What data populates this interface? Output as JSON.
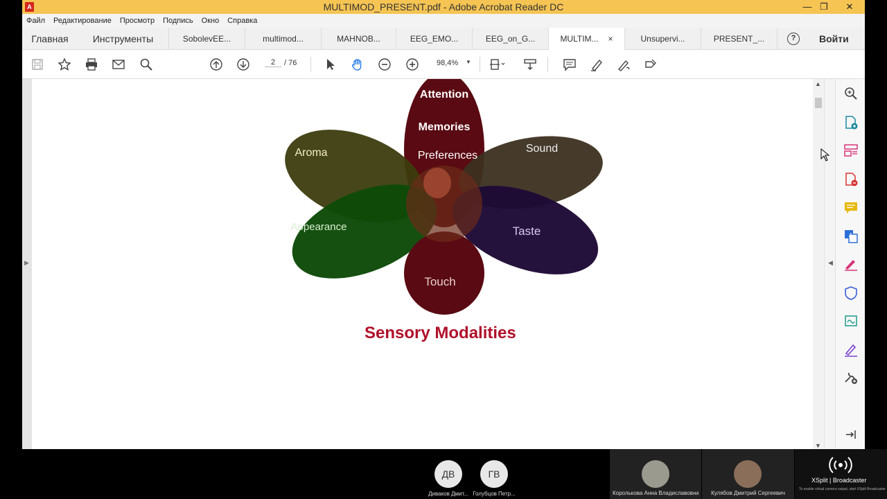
{
  "window": {
    "title": "MULTIMOD_PRESENT.pdf - Adobe Acrobat Reader DC",
    "min": "—",
    "max": "❐",
    "close": "✕"
  },
  "menu": [
    "Файл",
    "Редактирование",
    "Просмотр",
    "Подпись",
    "Окно",
    "Справка"
  ],
  "tabs": {
    "home": "Главная",
    "tools": "Инструменты",
    "docs": [
      {
        "label": "SobolevEE..."
      },
      {
        "label": "multimod..."
      },
      {
        "label": "MAHNOB..."
      },
      {
        "label": "EEG_EMO..."
      },
      {
        "label": "EEG_on_G..."
      },
      {
        "label": "MULTIM...",
        "close": "×"
      },
      {
        "label": "Unsupervi..."
      },
      {
        "label": "PRESENT_..."
      }
    ],
    "help": "?",
    "signin": "Войти"
  },
  "toolbar": {
    "page_current": "2",
    "page_total": "/ 76",
    "zoom": "98,4%",
    "zoom_caret": "▼"
  },
  "slide": {
    "petals": {
      "attention": "Attention",
      "memories": "Memories",
      "preferences": "Preferences",
      "aroma": "Aroma",
      "sound": "Sound",
      "appearance": "Appearance",
      "taste": "Taste",
      "touch": "Touch"
    },
    "title": "Sensory Modalities"
  },
  "conference": {
    "participants": [
      {
        "initials": "ДВ",
        "name": "Диваков Дмит..."
      },
      {
        "initials": "ГВ",
        "name": "Голубцов Петр..."
      }
    ],
    "video": [
      {
        "name": "Королькова Анна Владиславовна"
      },
      {
        "name": "Кулябов Дмитрий Сергеевич"
      }
    ],
    "xsplit": {
      "brand": "XSplit | Broadcaster",
      "note": "To enable virtual camera output, start XSplit Broadcaster"
    }
  },
  "colors": {
    "titlebar": "#f5c453",
    "title_red": "#b0102a"
  }
}
